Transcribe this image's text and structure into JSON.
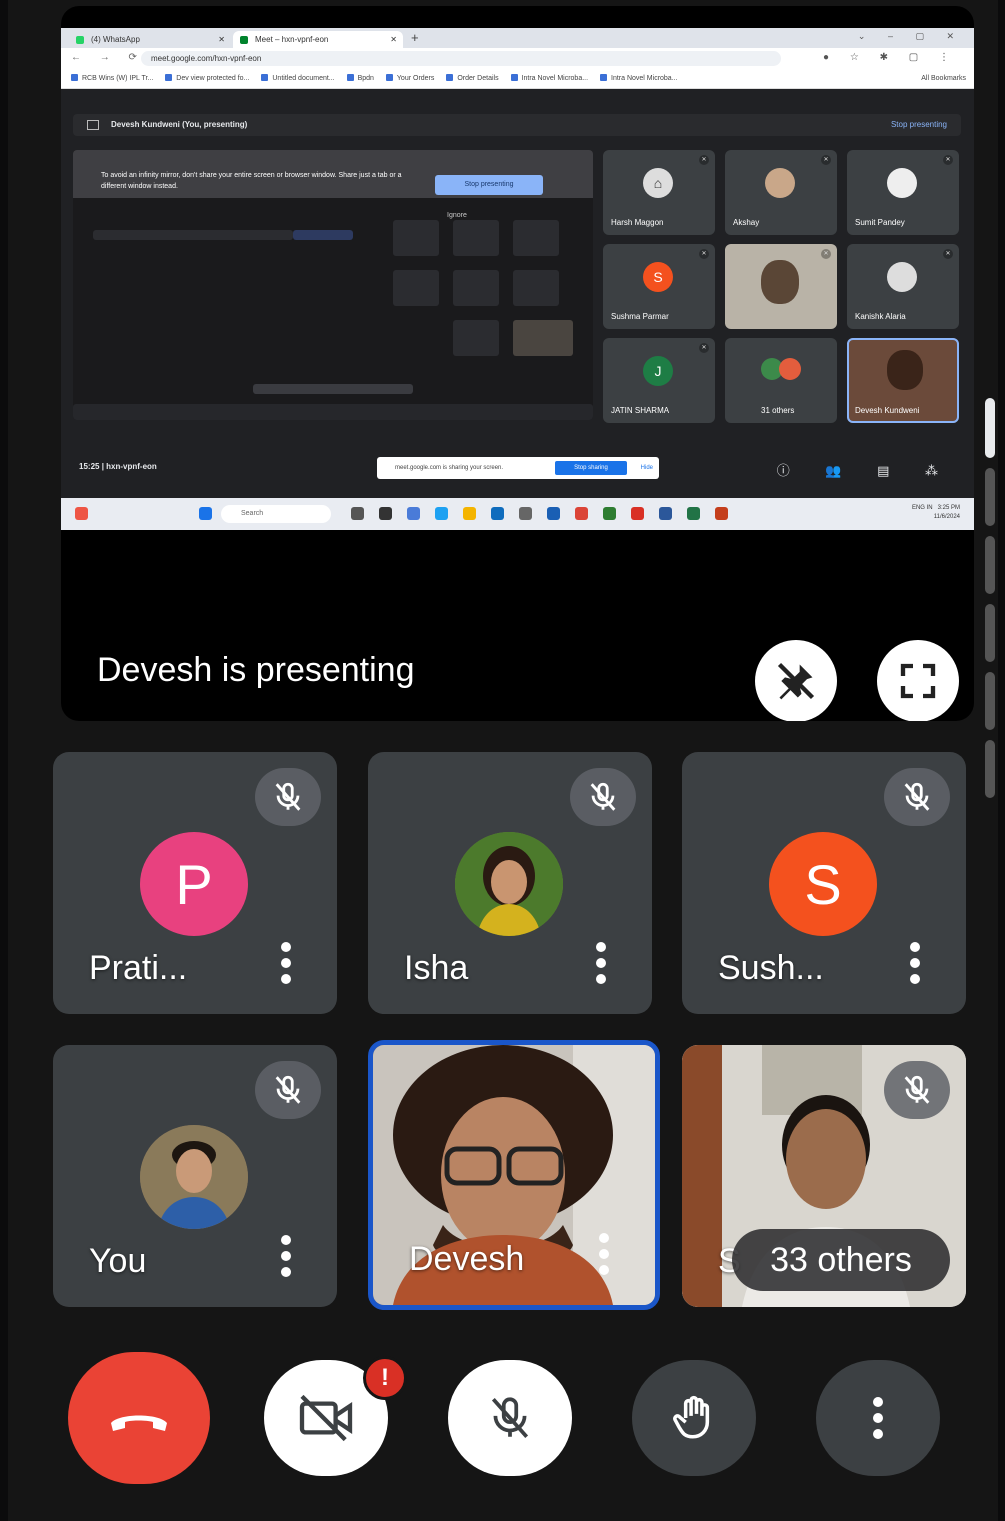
{
  "presentation": {
    "browser": {
      "tabs": [
        "(4) WhatsApp",
        "Meet – hxn-vpnf-eon"
      ],
      "url": "meet.google.com/hxn-vpnf-eon",
      "bookmarks": [
        "RCB Wins (W) IPL Tr...",
        "Dev view protected fo...",
        "Untitled document...",
        "Bpdn",
        "Your Orders",
        "Order Details",
        "Intra Novel Microba...",
        "Intra Novel Microba..."
      ],
      "bookmarks_end": "All Bookmarks"
    },
    "meet_header": {
      "presenter_label": "Devesh Kundweni (You, presenting)",
      "stop_link": "Stop presenting"
    },
    "mirror_warning": {
      "text": "To avoid an infinity mirror, don't share your entire screen or browser window. Share just a tab or a different window instead.",
      "stop_button": "Stop presenting",
      "ignore": "Ignore"
    },
    "mini_tiles": [
      {
        "name": "Harsh Maggon",
        "initial": ""
      },
      {
        "name": "Akshay",
        "initial": ""
      },
      {
        "name": "Sumit Pandey",
        "initial": ""
      },
      {
        "name": "Sushma Parmar",
        "initial": "S"
      },
      {
        "name": "",
        "initial": ""
      },
      {
        "name": "Kanishk Alaria",
        "initial": ""
      },
      {
        "name": "JATIN SHARMA",
        "initial": "J"
      },
      {
        "name": "31 others",
        "initial": ""
      },
      {
        "name": "Devesh Kundweni",
        "initial": ""
      }
    ],
    "meet_bottom": {
      "time": "15:25",
      "meeting_code": "hxn-vpnf-eon",
      "sharing_message": "meet.google.com is sharing your screen.",
      "stop_sharing": "Stop sharing",
      "hide": "Hide"
    },
    "taskbar": {
      "search": "Search",
      "tray_lang": "ENG IN",
      "tray_time": "3:25 PM",
      "tray_date": "11/6/2024"
    },
    "label": "Devesh is presenting"
  },
  "tiles": [
    {
      "name": "Prati...",
      "initial": "P",
      "color": "#e8417f"
    },
    {
      "name": "Isha",
      "initial": "",
      "color": "#6e8f3a"
    },
    {
      "name": "Sush...",
      "initial": "S",
      "color": "#f4511e"
    },
    {
      "name": "You",
      "initial": "",
      "color": "#7a6a55"
    },
    {
      "name": "Devesh",
      "initial": "",
      "color": "#6b4a3a"
    },
    {
      "name": "S",
      "initial": "",
      "color": "#d8d6d0"
    }
  ],
  "others_chip": "33 others",
  "controls": {
    "camera_badge": "!"
  },
  "colors": {
    "hangup": "#ea4335",
    "tile_bg": "#3c4043",
    "active_border": "#1a56c9"
  },
  "icons": [
    "call-end-icon",
    "camera-off-icon",
    "mic-off-icon",
    "raise-hand-icon",
    "more-vert-icon",
    "unpin-icon",
    "fullscreen-icon"
  ]
}
